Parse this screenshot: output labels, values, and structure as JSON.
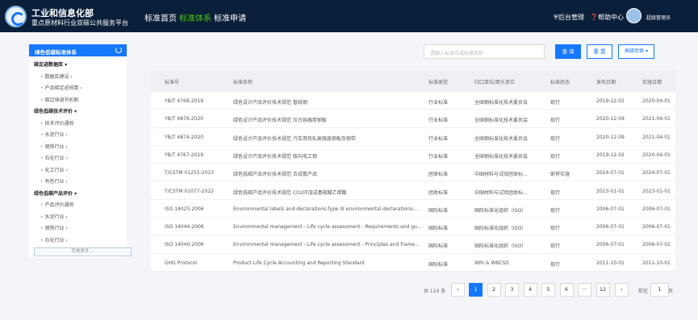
{
  "header": {
    "brand_title": "工业和信息化部",
    "brand_subtitle": "重点原材料行业双碳公共服务平台",
    "nav": [
      "标准首页",
      "标准体系",
      "标准申请"
    ],
    "admin": "后台管理",
    "help": "帮助中心",
    "username": "超级管理员"
  },
  "sidebar": {
    "title": "绿色低碳标准体系",
    "more": "查看更多 ⌄",
    "items": [
      {
        "label": "碳足迹数据库 ▾",
        "group": true,
        "indent": 0
      },
      {
        "label": "数据库建设 ›",
        "group": false,
        "indent": 1
      },
      {
        "label": "产品碳足迹核算 ›",
        "group": false,
        "indent": 1
      },
      {
        "label": "碳边境调节机制",
        "group": false,
        "indent": 1
      },
      {
        "label": "绿色低碳技术评价 ▾",
        "group": true,
        "indent": 0
      },
      {
        "label": "技术评价通则",
        "group": false,
        "indent": 1
      },
      {
        "label": "水泥行业 ›",
        "group": false,
        "indent": 1
      },
      {
        "label": "钢铁行业 ›",
        "group": false,
        "indent": 1
      },
      {
        "label": "石化行业 ›",
        "group": false,
        "indent": 1
      },
      {
        "label": "化工行业 ›",
        "group": false,
        "indent": 1
      },
      {
        "label": "有色行业 ›",
        "group": false,
        "indent": 1
      },
      {
        "label": "绿色低碳产品评价 ▾",
        "group": true,
        "indent": 0
      },
      {
        "label": "产品评价通则",
        "group": false,
        "indent": 1
      },
      {
        "label": "水泥行业 ›",
        "group": false,
        "indent": 1
      },
      {
        "label": "钢铁行业 ›",
        "group": false,
        "indent": 1
      },
      {
        "label": "石化行业 ›",
        "group": false,
        "indent": 1
      }
    ]
  },
  "search": {
    "placeholder": "请输入标准号或标准名称",
    "query": "查 询",
    "reset": "重 置",
    "advanced": "高级检索 ▾"
  },
  "table": {
    "headers": [
      "标准号",
      "标准名称",
      "标准类型",
      "归口单位/牵头单位",
      "标准状态",
      "发布日期",
      "实施日期"
    ],
    "rows": [
      [
        "YB/T 4768-2019",
        "绿色设计产品评价技术规范 管线钢",
        "行业标准",
        "全国钢标准化技术委员会",
        "现行",
        "2019-12-02",
        "2020-04-01"
      ],
      [
        "YB/T 4876-2020",
        "绿色设计产品评价技术规范 压力容器用钢板",
        "行业标准",
        "全国钢标准化技术委员会",
        "现行",
        "2020-12-09",
        "2021-04-01"
      ],
      [
        "YB/T 4874-2020",
        "绿色设计产品评价技术规范 汽车用热轧高强度钢板及钢带",
        "行业标准",
        "全国钢标准化技术委员会",
        "现行",
        "2020-12-09",
        "2021-04-01"
      ],
      [
        "YB/T 4767-2019",
        "绿色设计产品评价技术规范 取向电工钢",
        "行业标准",
        "全国钢标准化技术委员会",
        "现行",
        "2019-12-02",
        "2020-04-01"
      ],
      [
        "T/CSTM 01255-2023",
        "绿色低碳产品评价技术规范 合成氨产品",
        "团体标准",
        "中国材料与试验团体标...",
        "即将实施",
        "2024-07-01",
        "2024-07-01"
      ],
      [
        "T/CSTM 01077-2022",
        "绿色低碳产品评价技术规范 CO2环加成基碳酸乙烯酯",
        "团体标准",
        "中国材料与试验团体标...",
        "现行",
        "2023-01-01",
        "2023-01-01"
      ],
      [
        "ISO 14025:2006",
        "Environmental labels and declarations-Type III environmental declarations-...",
        "国际标准",
        "国际标准化组织（ISO）",
        "现行",
        "2006-07-01",
        "2006-07-01"
      ],
      [
        "ISO 14044:2006",
        "Environmental management - Life cycle assessment - Requirements and gu...",
        "国际标准",
        "国际标准化组织（ISO）",
        "现行",
        "2006-07-01",
        "2006-07-01"
      ],
      [
        "ISO 14040:2006",
        "Environmental management - Life cycle assessment - Principles and frame...",
        "国际标准",
        "国际标准化组织（ISO）",
        "现行",
        "2006-07-01",
        "2006-07-01"
      ],
      [
        "GHG Protocol",
        "Product Life Cycle Accounting and Reporting Standard",
        "国际标准",
        "WRI & WBCSD",
        "现行",
        "2011-10-01",
        "2011-10-01"
      ]
    ]
  },
  "pagination": {
    "total": "共 119 条",
    "prev": "‹",
    "next": "›",
    "pages": [
      "1",
      "2",
      "3",
      "4",
      "5",
      "6",
      "···",
      "12"
    ],
    "current": "1",
    "goto_label": "前往",
    "goto_value": "1",
    "goto_unit": "页"
  }
}
